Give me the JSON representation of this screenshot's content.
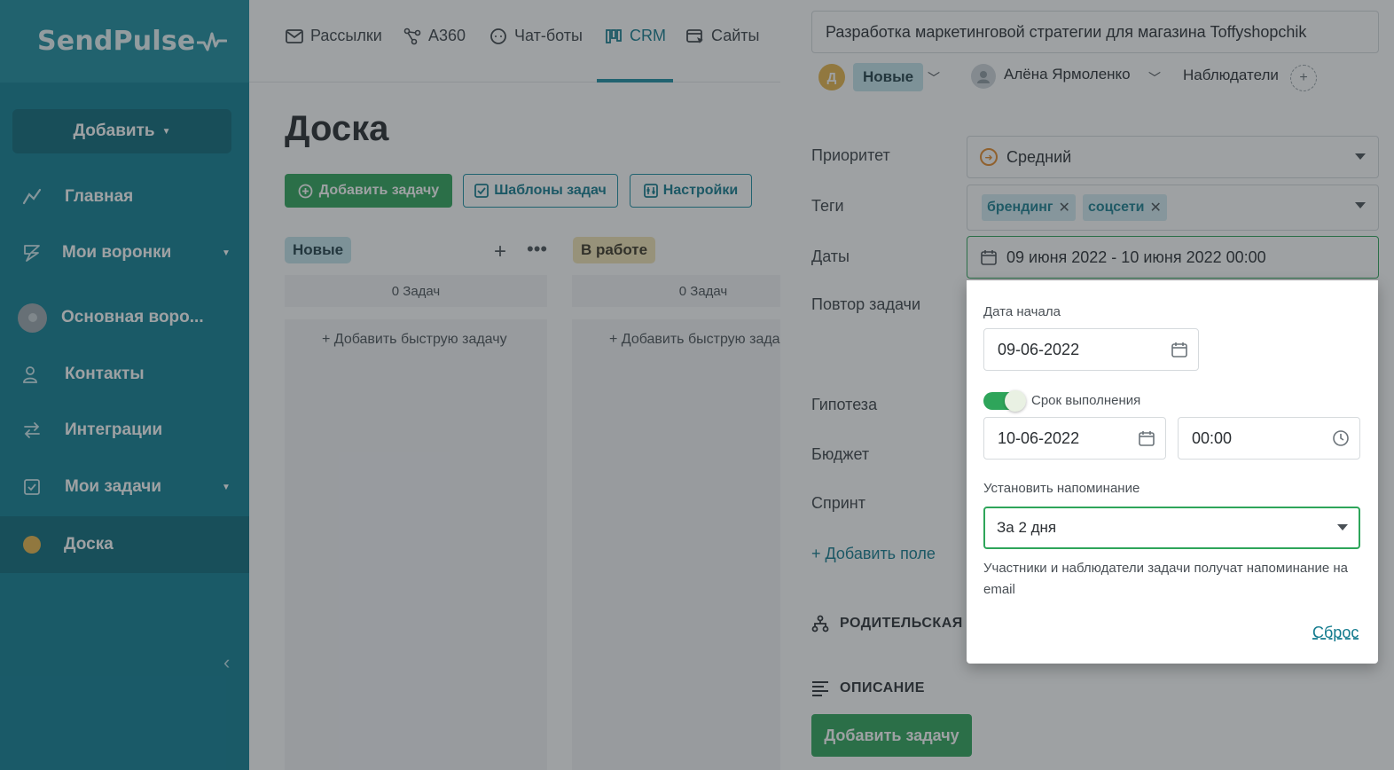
{
  "sidebar": {
    "logo": "SendPulse",
    "add_button": "Добавить",
    "items": [
      {
        "label": "Главная"
      },
      {
        "label": "Мои воронки"
      },
      {
        "label": "Основная воро..."
      },
      {
        "label": "Контакты"
      },
      {
        "label": "Интеграции"
      },
      {
        "label": "Мои задачи"
      },
      {
        "label": "Доска"
      }
    ]
  },
  "topnav": {
    "items": [
      {
        "label": "Рассылки"
      },
      {
        "label": "A360"
      },
      {
        "label": "Чат-боты"
      },
      {
        "label": "CRM"
      },
      {
        "label": "Сайты"
      }
    ],
    "active": "CRM"
  },
  "board": {
    "title": "Доска",
    "add_task": "Добавить задачу",
    "templates": "Шаблоны задач",
    "settings": "Настройки",
    "columns": [
      {
        "name": "Новые",
        "count": "0 Задач",
        "quick_add": "Добавить быструю задачу",
        "color": "#c4e4ec"
      },
      {
        "name": "В работе",
        "count": "0 Задач",
        "quick_add": "Добавить быструю задачу",
        "color": "#f3e3b5"
      }
    ]
  },
  "panel": {
    "task_title": "Разработка маркетинговой стратегии для магазина Toffyshopchik",
    "avatar_letter": "Д",
    "status": "Новые",
    "assignee": "Алёна Ярмоленко",
    "watchers": "Наблюдатели",
    "fields": {
      "priority_label": "Приоритет",
      "priority_value": "Средний",
      "tags_label": "Теги",
      "tags": [
        "брендинг",
        "соцсети"
      ],
      "dates_label": "Даты",
      "dates_value": "09 июня 2022 - 10 июня 2022 00:00",
      "repeat_label": "Повтор задачи",
      "hypothesis_label": "Гипотеза",
      "budget_label": "Бюджет",
      "sprint_label": "Спринт"
    },
    "add_field": "+ Добавить поле",
    "parent_section": "РОДИТЕЛЬСКАЯ З",
    "description_section": "ОПИСАНИЕ",
    "submit": "Добавить задачу"
  },
  "date_popover": {
    "start_label": "Дата начала",
    "start_value": "09-06-2022",
    "deadline_toggle_label": "Срок выполнения",
    "deadline_enabled": true,
    "deadline_date": "10-06-2022",
    "deadline_time": "00:00",
    "reminder_label": "Установить напоминание",
    "reminder_value": "За 2 дня",
    "hint": "Участники и наблюдатели задачи получат напоминание на email",
    "reset": "Сброс"
  }
}
